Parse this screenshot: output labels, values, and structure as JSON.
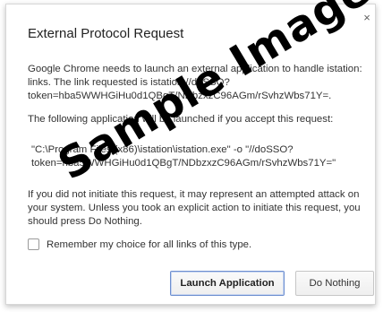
{
  "dialog": {
    "title": "External Protocol Request",
    "close_glyph": "×",
    "para1": "Google Chrome needs to launch an external application to handle istation: links. The link requested is istation://doSSO?token=hba5WWHGiHu0d1QBgT/NDbzxzC96AGm/rSvhzWbs71Y=.",
    "para2": "The following application will be launched if you accept this request:",
    "para3": "\"C:\\Program Files (x86)\\istation\\istation.exe\" -o \"//doSSO?token=hba5WWHGiHu0d1QBgT/NDbzxzC96AGm/rSvhzWbs71Y=\"",
    "para4": "If you did not initiate this request, it may represent an attempted attack on your system. Unless you took an explicit action to initiate this request, you should press Do Nothing.",
    "checkbox_label": "Remember my choice for all links of this type.",
    "checkbox_checked": false,
    "primary_button": "Launch Application",
    "secondary_button": "Do Nothing"
  },
  "watermark": "Sample Image"
}
